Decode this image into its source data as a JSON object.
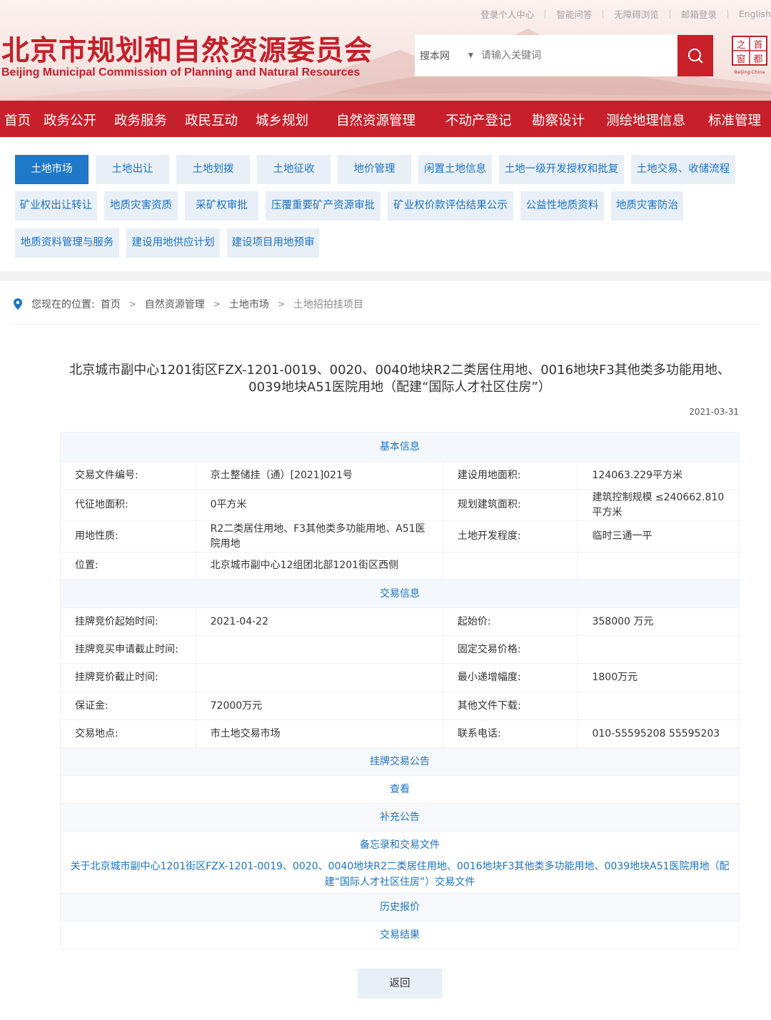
{
  "header": {
    "top_links": [
      "登录个人中心",
      "智能问答",
      "无障碍浏览",
      "邮箱登录",
      "English"
    ],
    "title_cn": "北京市规划和自然资源委员会",
    "title_en": "Beijing Municipal Commission of Planning and Natural Resources",
    "search": {
      "scope": "搜本网",
      "placeholder": "请输入关键词"
    },
    "badge": {
      "chars": [
        "首",
        "都",
        "之",
        "窗"
      ],
      "sub": "Beijing·China"
    }
  },
  "nav": [
    "首页",
    "政务公开",
    "政务服务",
    "政民互动",
    "城乡规划",
    "自然资源管理",
    "不动产登记",
    "勘察设计",
    "测绘地理信息",
    "标准管理"
  ],
  "subnav": {
    "active": "土地市场",
    "items": [
      "土地市场",
      "土地出让",
      "土地划拨",
      "土地征收",
      "地价管理",
      "闲置土地信息",
      "土地一级开发授权和批复",
      "土地交易、收储流程",
      "矿业权出让转让",
      "地质灾害资质",
      "采矿权审批",
      "压覆重要矿产资源审批",
      "矿业权价款评估结果公示",
      "公益性地质资料",
      "地质灾害防治",
      "地质资料管理与服务",
      "建设用地供应计划",
      "建设项目用地预审"
    ]
  },
  "breadcrumb": {
    "prefix": "您现在的位置:",
    "items": [
      "首页",
      "自然资源管理",
      "土地市场",
      "土地招拍挂项目"
    ]
  },
  "article": {
    "title": "北京城市副中心1201街区FZX-1201-0019、0020、0040地块R2二类居住用地、0016地块F3其他类多功能用地、0039地块A51医院用地（配建“国际人才社区住房”）",
    "date": "2021-03-31"
  },
  "basic_info": {
    "heading": "基本信息",
    "rows": [
      [
        "交易文件编号:",
        "京土整储挂（通）[2021]021号",
        "建设用地面积:",
        "124063.229平方米"
      ],
      [
        "代征地面积:",
        "0平方米",
        "规划建筑面积:",
        "建筑控制规模 ≤240662.810平方米"
      ],
      [
        "用地性质:",
        "R2二类居住用地、F3其他类多功能用地、A51医院用地",
        "土地开发程度:",
        "临时三通一平"
      ],
      [
        "位置:",
        "北京城市副中心12组团北部1201街区西侧",
        "",
        ""
      ]
    ]
  },
  "trade_info": {
    "heading": "交易信息",
    "rows": [
      [
        "挂牌竞价起始时间:",
        "2021-04-22",
        "起始价:",
        "358000 万元"
      ],
      [
        "挂牌竞买申请截止时间:",
        "",
        "固定交易价格:",
        ""
      ],
      [
        "挂牌竞价截止时间:",
        "",
        "最小递增幅度:",
        "1800万元"
      ],
      [
        "保证金:",
        "72000万元",
        "其他文件下载:",
        ""
      ],
      [
        "交易地点:",
        "市土地交易市场",
        "联系电话:",
        "010-55595208 55595203"
      ]
    ]
  },
  "sections": {
    "listing_notice": "挂牌交易公告",
    "view": "查看",
    "supplement": "补充公告",
    "memo_files": "备忘录和交易文件",
    "file_link": "关于北京城市副中心1201街区FZX-1201-0019、0020、0040地块R2二类居住用地、0016地块F3其他类多功能用地、0039地块A51医院用地（配建“国际人才社区住房”）交易文件",
    "history": "历史报价",
    "result": "交易结果"
  },
  "back_label": "返回",
  "colors": {
    "brand_red": "#c8202b",
    "link_blue": "#1a73c2",
    "chip_bg": "#e9eff7",
    "chip_active": "#1f78c8"
  }
}
